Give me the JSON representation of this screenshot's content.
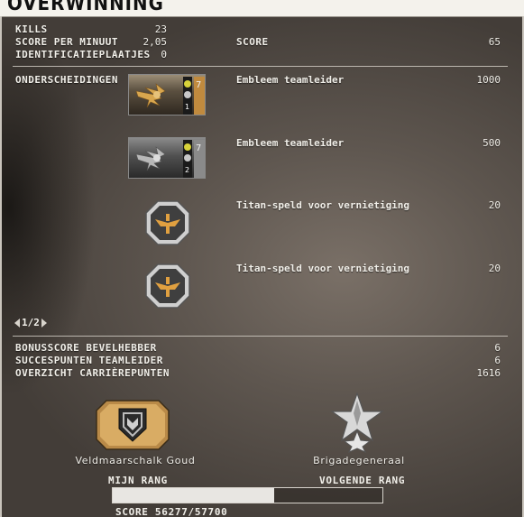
{
  "title": "OVERWINNING",
  "stats": [
    {
      "label": "KILLS",
      "value": "23"
    },
    {
      "label": "SCORE PER MINUUT",
      "value": "2,05"
    },
    {
      "label": "IDENTIFICATIEPLAATJES",
      "value": "0"
    }
  ],
  "score": {
    "label": "SCORE",
    "value": "65"
  },
  "awards_label": "ONDERSCHEIDINGEN",
  "awards": [
    {
      "name": "Embleem teamleider",
      "value": "1000",
      "icon": "gold-eagle-emblem-icon",
      "tier": "1"
    },
    {
      "name": "Embleem teamleider",
      "value": "500",
      "icon": "silver-eagle-emblem-icon",
      "tier": "2"
    },
    {
      "name": "Titan-speld voor vernietiging",
      "value": "20",
      "icon": "titan-pin-icon"
    },
    {
      "name": "Titan-speld voor vernietiging",
      "value": "20",
      "icon": "titan-pin-icon"
    }
  ],
  "pager": {
    "text": "1/2"
  },
  "bonus": [
    {
      "label": "BONUSSCORE BEVELHEBBER",
      "value": "6"
    },
    {
      "label": "SUCCESPUNTEN TEAMLEIDER",
      "value": "6"
    },
    {
      "label": "OVERZICHT CARRIÈREPUNTEN",
      "value": "1616"
    }
  ],
  "current_rank": {
    "name": "Veldmaarschalk Goud",
    "header": "MIJN RANG",
    "icon": "field-marshal-gold-rank-icon"
  },
  "next_rank": {
    "name": "Brigadegeneraal",
    "header": "VOLGENDE RANG",
    "icon": "brigadier-general-star-rank-icon"
  },
  "progress": {
    "text": "SCORE 56277/57700",
    "current": 56277,
    "target": 57700,
    "fraction": 0.6
  },
  "colors": {
    "title_bg": "#f4f2ec",
    "text": "#f1efe9",
    "gold": "#c8a062",
    "bar_fill": "#e8e6e2"
  }
}
